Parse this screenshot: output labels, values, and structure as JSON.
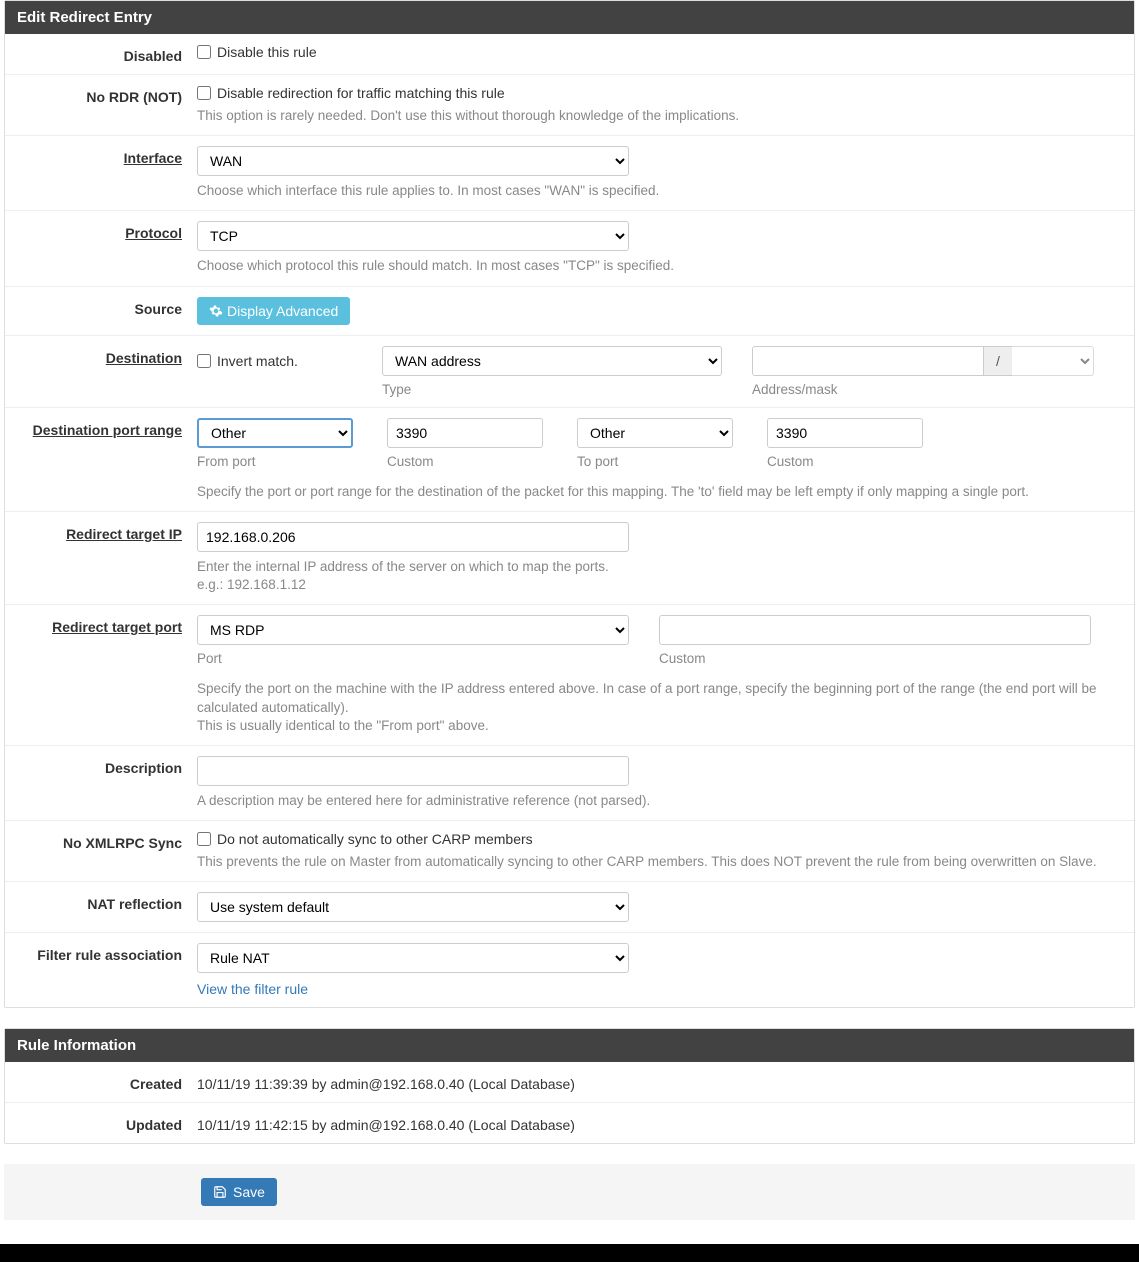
{
  "panel1": {
    "title": "Edit Redirect Entry"
  },
  "disabled": {
    "label": "Disabled",
    "checkbox_label": "Disable this rule"
  },
  "nordr": {
    "label": "No RDR (NOT)",
    "checkbox_label": "Disable redirection for traffic matching this rule",
    "help": "This option is rarely needed. Don't use this without thorough knowledge of the implications."
  },
  "interface": {
    "label": "Interface",
    "value": "WAN",
    "help": "Choose which interface this rule applies to. In most cases \"WAN\" is specified."
  },
  "protocol": {
    "label": "Protocol",
    "value": "TCP",
    "help": "Choose which protocol this rule should match. In most cases \"TCP\" is specified."
  },
  "source": {
    "label": "Source",
    "button": "Display Advanced"
  },
  "destination": {
    "label": "Destination",
    "invert_label": "Invert match.",
    "type_value": "WAN address",
    "type_sub": "Type",
    "addr_sub": "Address/mask",
    "slash": "/"
  },
  "destport": {
    "label": "Destination port range",
    "from_port_value": "Other",
    "from_port_sub": "From port",
    "from_custom_value": "3390",
    "from_custom_sub": "Custom",
    "to_port_value": "Other",
    "to_port_sub": "To port",
    "to_custom_value": "3390",
    "to_custom_sub": "Custom",
    "help": "Specify the port or port range for the destination of the packet for this mapping. The 'to' field may be left empty if only mapping a single port."
  },
  "targetip": {
    "label": "Redirect target IP",
    "value": "192.168.0.206",
    "help": "Enter the internal IP address of the server on which to map the ports.\ne.g.: 192.168.1.12"
  },
  "targetport": {
    "label": "Redirect target port",
    "port_value": "MS RDP",
    "port_sub": "Port",
    "custom_sub": "Custom",
    "help": "Specify the port on the machine with the IP address entered above. In case of a port range, specify the beginning port of the range (the end port will be calculated automatically).\nThis is usually identical to the \"From port\" above."
  },
  "description": {
    "label": "Description",
    "help": "A description may be entered here for administrative reference (not parsed)."
  },
  "xmlrpc": {
    "label": "No XMLRPC Sync",
    "checkbox_label": "Do not automatically sync to other CARP members",
    "help": "This prevents the rule on Master from automatically syncing to other CARP members. This does NOT prevent the rule from being overwritten on Slave."
  },
  "natreflect": {
    "label": "NAT reflection",
    "value": "Use system default"
  },
  "filterassoc": {
    "label": "Filter rule association",
    "value": "Rule NAT",
    "link": "View the filter rule"
  },
  "panel2": {
    "title": "Rule Information"
  },
  "created": {
    "label": "Created",
    "value": "10/11/19 11:39:39 by admin@192.168.0.40 (Local Database)"
  },
  "updated": {
    "label": "Updated",
    "value": "10/11/19 11:42:15 by admin@192.168.0.40 (Local Database)"
  },
  "save": {
    "label": "Save"
  }
}
